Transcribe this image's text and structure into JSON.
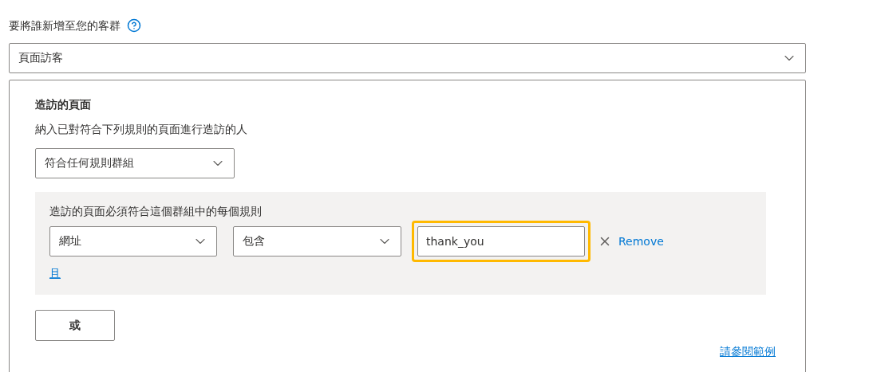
{
  "audience": {
    "label": "要將誰新增至您的客群",
    "value": "頁面訪客"
  },
  "panel": {
    "title": "造訪的頁面",
    "description": "納入已對符合下列規則的頁面進行造訪的人",
    "match": "符合任何規則群組",
    "groups": [
      {
        "title": "造訪的頁面必須符合這個群組中的每個規則",
        "and_link": "且",
        "rules": [
          {
            "field": "網址",
            "operator": "包含",
            "value": "thank_you",
            "highlighted": true,
            "remove": "Remove"
          }
        ]
      }
    ],
    "or_button": "或",
    "examples_link": "請參閱範例"
  }
}
